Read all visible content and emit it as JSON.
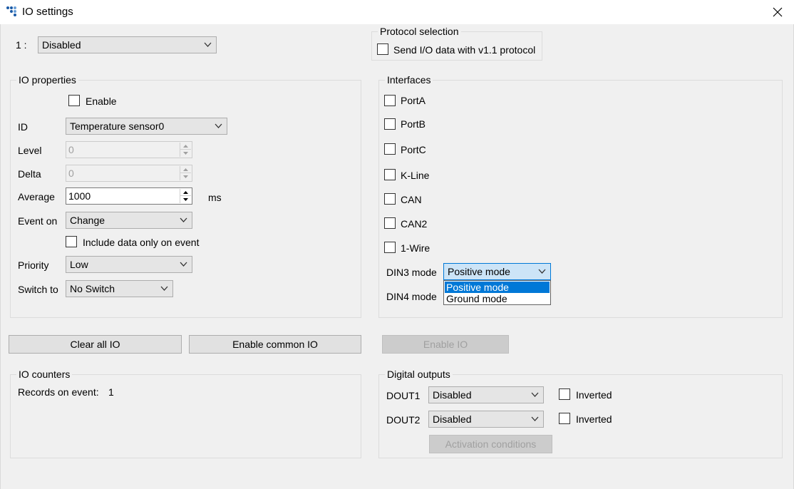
{
  "window": {
    "title": "IO settings"
  },
  "io_selector": {
    "label": "1 :",
    "value": "Disabled"
  },
  "protocol_selection": {
    "legend": "Protocol selection",
    "checkbox_label": "Send I/O data with v1.1 protocol",
    "checked": false
  },
  "io_properties": {
    "legend": "IO properties",
    "enable_label": "Enable",
    "id_label": "ID",
    "id_value": "Temperature sensor0",
    "level_label": "Level",
    "level_value": "0",
    "delta_label": "Delta",
    "delta_value": "0",
    "average_label": "Average",
    "average_value": "1000",
    "average_unit": "ms",
    "event_on_label": "Event on",
    "event_on_value": "Change",
    "include_data_label": "Include data only on event",
    "priority_label": "Priority",
    "priority_value": "Low",
    "switch_to_label": "Switch to",
    "switch_to_value": "No Switch"
  },
  "interfaces": {
    "legend": "Interfaces",
    "items": [
      "PortA",
      "PortB",
      "PortC",
      "K-Line",
      "CAN",
      "CAN2",
      "1-Wire"
    ],
    "din3_label": "DIN3 mode",
    "din3_value": "Positive mode",
    "din4_label": "DIN4 mode",
    "dropdown_options": [
      "Positive mode",
      "Ground mode"
    ],
    "dropdown_selected": "Positive mode"
  },
  "buttons": {
    "clear_all": "Clear all IO",
    "enable_common": "Enable common IO",
    "enable_io": "Enable IO",
    "activation_conditions": "Activation conditions"
  },
  "io_counters": {
    "legend": "IO counters",
    "records_label": "Records on event:",
    "records_value": "1"
  },
  "digital_outputs": {
    "legend": "Digital outputs",
    "dout1_label": "DOUT1",
    "dout1_value": "Disabled",
    "dout2_label": "DOUT2",
    "dout2_value": "Disabled",
    "inverted_label": "Inverted"
  },
  "colors": {
    "accent": "#0078d7",
    "selection": "#cce4f7",
    "window_bg": "#f0f0f0"
  }
}
